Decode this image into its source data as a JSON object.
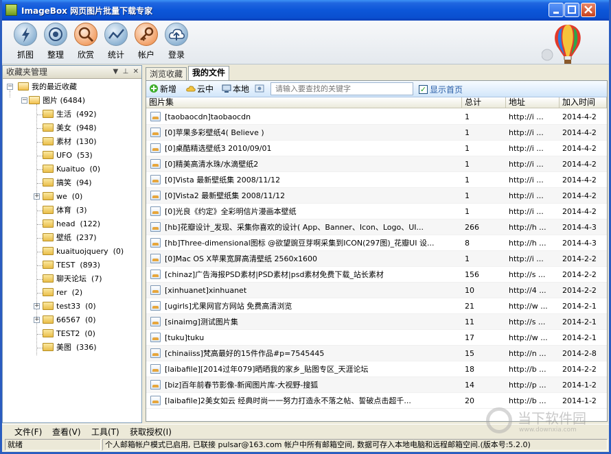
{
  "window": {
    "title": "ImageBox 网页图片批量下载专家",
    "controls": [
      "minimize",
      "maximize",
      "close"
    ]
  },
  "toolbar": {
    "items": [
      {
        "label": "抓图",
        "icon": "lightning-icon"
      },
      {
        "label": "整理",
        "icon": "target-icon"
      },
      {
        "label": "欣赏",
        "icon": "magnifier-icon"
      },
      {
        "label": "统计",
        "icon": "chart-icon"
      },
      {
        "label": "帐户",
        "icon": "key-icon"
      },
      {
        "label": "登录",
        "icon": "cloud-upload-icon"
      }
    ]
  },
  "left_panel": {
    "title": "收藏夹管理",
    "header_buttons": [
      "▼",
      "⊥",
      "✕"
    ],
    "tree": {
      "root": "我的最近收藏",
      "category": {
        "name": "图片",
        "count": "(6484)"
      },
      "items": [
        {
          "name": "生活",
          "count": "(492)",
          "expandable": false
        },
        {
          "name": "美女",
          "count": "(948)",
          "expandable": false
        },
        {
          "name": "素材",
          "count": "(130)",
          "expandable": false
        },
        {
          "name": "UFO",
          "count": "(53)",
          "expandable": false
        },
        {
          "name": "Kuaituo",
          "count": "(0)",
          "expandable": false
        },
        {
          "name": "搞笑",
          "count": "(94)",
          "expandable": false
        },
        {
          "name": "we",
          "count": "(0)",
          "expandable": true
        },
        {
          "name": "体育",
          "count": "(3)",
          "expandable": false
        },
        {
          "name": "head",
          "count": "(122)",
          "expandable": false
        },
        {
          "name": "壁纸",
          "count": "(237)",
          "expandable": false
        },
        {
          "name": "kuaituojquery",
          "count": "(0)",
          "expandable": false
        },
        {
          "name": "TEST",
          "count": "(893)",
          "expandable": false
        },
        {
          "name": "聊天论坛",
          "count": "(7)",
          "expandable": false
        },
        {
          "name": "rer",
          "count": "(2)",
          "expandable": false
        },
        {
          "name": "test33",
          "count": "(0)",
          "expandable": true
        },
        {
          "name": "66567",
          "count": "(0)",
          "expandable": true
        },
        {
          "name": "TEST2",
          "count": "(0)",
          "expandable": false
        },
        {
          "name": "美图",
          "count": "(336)",
          "expandable": false
        }
      ]
    }
  },
  "tabs": [
    {
      "label": "浏览收藏",
      "active": false
    },
    {
      "label": "我的文件",
      "active": true
    }
  ],
  "actions": {
    "new": "新增",
    "cloud": "云中",
    "local": "本地",
    "search_placeholder": "请输入要查找的关键字",
    "show_home": "显示首页",
    "show_home_checked": true
  },
  "table": {
    "columns": [
      "图片集",
      "总计",
      "地址",
      "加入时间"
    ],
    "rows": [
      {
        "name": "[taobaocdn]taobaocdn",
        "total": "1",
        "url": "http://i ...",
        "date": "2014-4-2"
      },
      {
        "name": "[0]苹果多彩壁纸4( Believe )",
        "total": "1",
        "url": "http://i ...",
        "date": "2014-4-2"
      },
      {
        "name": "[0]桌酷精选壁纸3 2010/09/01",
        "total": "1",
        "url": "http://i ...",
        "date": "2014-4-2"
      },
      {
        "name": "[0]精美高清水珠/水滴壁纸2",
        "total": "1",
        "url": "http://i ...",
        "date": "2014-4-2"
      },
      {
        "name": "[0]Vista 最新壁纸集 2008/11/12",
        "total": "1",
        "url": "http://i ...",
        "date": "2014-4-2"
      },
      {
        "name": "[0]Vista2 最新壁纸集 2008/11/12",
        "total": "1",
        "url": "http://i ...",
        "date": "2014-4-2"
      },
      {
        "name": "[0]光良《约定》全彩明信片漫画本壁纸",
        "total": "1",
        "url": "http://i ...",
        "date": "2014-4-2"
      },
      {
        "name": "[hb]花瓣设计_发现、采集你喜欢的设计( App、Banner、Icon、Logo、UI...",
        "total": "266",
        "url": "http://h ...",
        "date": "2014-4-3"
      },
      {
        "name": "[hb]Three-dimensional图标 @欲望豌豆芽啊采集到ICON(297图)_花瓣UI 设...",
        "total": "8",
        "url": "http://h ...",
        "date": "2014-4-3"
      },
      {
        "name": "[0]Mac OS X苹果宽屏高清壁纸 2560x1600",
        "total": "1",
        "url": "http://i ...",
        "date": "2014-2-2"
      },
      {
        "name": "[chinaz]广告海报PSD素材|PSD素材|psd素材免费下载_站长素材",
        "total": "156",
        "url": "http://s ...",
        "date": "2014-2-2"
      },
      {
        "name": "[xinhuanet]xinhuanet",
        "total": "10",
        "url": "http://4 ...",
        "date": "2014-2-2"
      },
      {
        "name": "[ugirls]尤果网官方网站 免费高清浏览",
        "total": "21",
        "url": "http://w ...",
        "date": "2014-2-1"
      },
      {
        "name": "[sinaimg]测试图片集",
        "total": "11",
        "url": "http://s ...",
        "date": "2014-2-1"
      },
      {
        "name": "[tuku]tuku",
        "total": "17",
        "url": "http://w ...",
        "date": "2014-2-1"
      },
      {
        "name": "[chinaiiss]梵高最好的15件作品#p=7545445",
        "total": "15",
        "url": "http://n ...",
        "date": "2014-2-8"
      },
      {
        "name": "[laibafile][2014过年079]晒晒我的家乡_贴图专区_天涯论坛",
        "total": "18",
        "url": "http://b ...",
        "date": "2014-2-2"
      },
      {
        "name": "[biz]百年前春节影像-新闻图片库-大视野-搜狐",
        "total": "14",
        "url": "http://p ...",
        "date": "2014-1-2"
      },
      {
        "name": "[laibafile]2美女如云 经典时尚一一努力打造永不落之帖、誓破点击超千...",
        "total": "20",
        "url": "http://b ...",
        "date": "2014-1-2"
      }
    ]
  },
  "menu": {
    "items": [
      "文件(F)",
      "查看(V)",
      "工具(T)",
      "获取授权(I)"
    ]
  },
  "status": {
    "ready": "就绪",
    "message": "个人邮箱帐户模式已启用, 已联接 pulsar@163.com 帐户中所有邮箱空间, 数据可存入本地电脑和远程邮箱空间.(版本号:5.2.0)"
  },
  "watermark": {
    "text": "当下软件园",
    "url": "www.downxia.com"
  },
  "colors": {
    "titlebar": "#0a4fd0",
    "accent_blue": "#2b5fa8",
    "checkbox_green": "#21a121"
  }
}
